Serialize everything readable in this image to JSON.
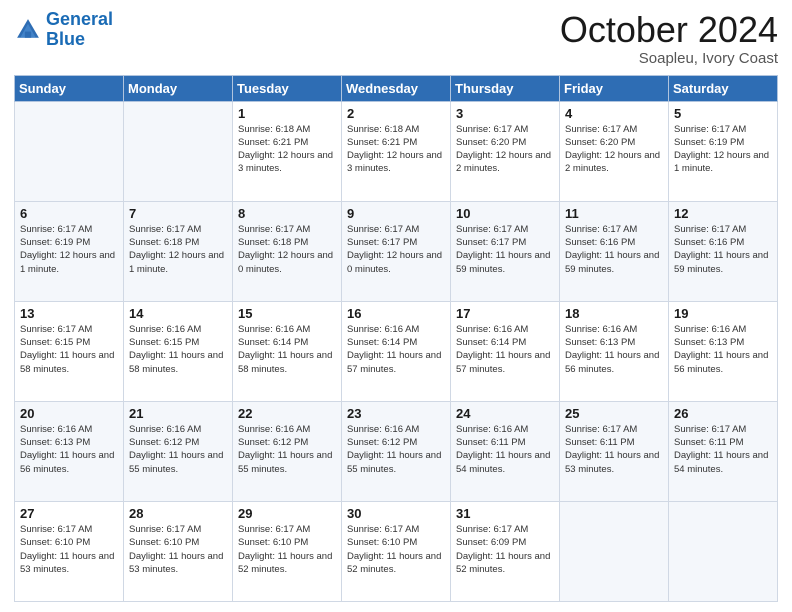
{
  "header": {
    "logo_line1": "General",
    "logo_line2": "Blue",
    "month": "October 2024",
    "location": "Soapleu, Ivory Coast"
  },
  "weekdays": [
    "Sunday",
    "Monday",
    "Tuesday",
    "Wednesday",
    "Thursday",
    "Friday",
    "Saturday"
  ],
  "weeks": [
    [
      {
        "day": null
      },
      {
        "day": null
      },
      {
        "day": "1",
        "sunrise": "Sunrise: 6:18 AM",
        "sunset": "Sunset: 6:21 PM",
        "daylight": "Daylight: 12 hours and 3 minutes."
      },
      {
        "day": "2",
        "sunrise": "Sunrise: 6:18 AM",
        "sunset": "Sunset: 6:21 PM",
        "daylight": "Daylight: 12 hours and 3 minutes."
      },
      {
        "day": "3",
        "sunrise": "Sunrise: 6:17 AM",
        "sunset": "Sunset: 6:20 PM",
        "daylight": "Daylight: 12 hours and 2 minutes."
      },
      {
        "day": "4",
        "sunrise": "Sunrise: 6:17 AM",
        "sunset": "Sunset: 6:20 PM",
        "daylight": "Daylight: 12 hours and 2 minutes."
      },
      {
        "day": "5",
        "sunrise": "Sunrise: 6:17 AM",
        "sunset": "Sunset: 6:19 PM",
        "daylight": "Daylight: 12 hours and 1 minute."
      }
    ],
    [
      {
        "day": "6",
        "sunrise": "Sunrise: 6:17 AM",
        "sunset": "Sunset: 6:19 PM",
        "daylight": "Daylight: 12 hours and 1 minute."
      },
      {
        "day": "7",
        "sunrise": "Sunrise: 6:17 AM",
        "sunset": "Sunset: 6:18 PM",
        "daylight": "Daylight: 12 hours and 1 minute."
      },
      {
        "day": "8",
        "sunrise": "Sunrise: 6:17 AM",
        "sunset": "Sunset: 6:18 PM",
        "daylight": "Daylight: 12 hours and 0 minutes."
      },
      {
        "day": "9",
        "sunrise": "Sunrise: 6:17 AM",
        "sunset": "Sunset: 6:17 PM",
        "daylight": "Daylight: 12 hours and 0 minutes."
      },
      {
        "day": "10",
        "sunrise": "Sunrise: 6:17 AM",
        "sunset": "Sunset: 6:17 PM",
        "daylight": "Daylight: 11 hours and 59 minutes."
      },
      {
        "day": "11",
        "sunrise": "Sunrise: 6:17 AM",
        "sunset": "Sunset: 6:16 PM",
        "daylight": "Daylight: 11 hours and 59 minutes."
      },
      {
        "day": "12",
        "sunrise": "Sunrise: 6:17 AM",
        "sunset": "Sunset: 6:16 PM",
        "daylight": "Daylight: 11 hours and 59 minutes."
      }
    ],
    [
      {
        "day": "13",
        "sunrise": "Sunrise: 6:17 AM",
        "sunset": "Sunset: 6:15 PM",
        "daylight": "Daylight: 11 hours and 58 minutes."
      },
      {
        "day": "14",
        "sunrise": "Sunrise: 6:16 AM",
        "sunset": "Sunset: 6:15 PM",
        "daylight": "Daylight: 11 hours and 58 minutes."
      },
      {
        "day": "15",
        "sunrise": "Sunrise: 6:16 AM",
        "sunset": "Sunset: 6:14 PM",
        "daylight": "Daylight: 11 hours and 58 minutes."
      },
      {
        "day": "16",
        "sunrise": "Sunrise: 6:16 AM",
        "sunset": "Sunset: 6:14 PM",
        "daylight": "Daylight: 11 hours and 57 minutes."
      },
      {
        "day": "17",
        "sunrise": "Sunrise: 6:16 AM",
        "sunset": "Sunset: 6:14 PM",
        "daylight": "Daylight: 11 hours and 57 minutes."
      },
      {
        "day": "18",
        "sunrise": "Sunrise: 6:16 AM",
        "sunset": "Sunset: 6:13 PM",
        "daylight": "Daylight: 11 hours and 56 minutes."
      },
      {
        "day": "19",
        "sunrise": "Sunrise: 6:16 AM",
        "sunset": "Sunset: 6:13 PM",
        "daylight": "Daylight: 11 hours and 56 minutes."
      }
    ],
    [
      {
        "day": "20",
        "sunrise": "Sunrise: 6:16 AM",
        "sunset": "Sunset: 6:13 PM",
        "daylight": "Daylight: 11 hours and 56 minutes."
      },
      {
        "day": "21",
        "sunrise": "Sunrise: 6:16 AM",
        "sunset": "Sunset: 6:12 PM",
        "daylight": "Daylight: 11 hours and 55 minutes."
      },
      {
        "day": "22",
        "sunrise": "Sunrise: 6:16 AM",
        "sunset": "Sunset: 6:12 PM",
        "daylight": "Daylight: 11 hours and 55 minutes."
      },
      {
        "day": "23",
        "sunrise": "Sunrise: 6:16 AM",
        "sunset": "Sunset: 6:12 PM",
        "daylight": "Daylight: 11 hours and 55 minutes."
      },
      {
        "day": "24",
        "sunrise": "Sunrise: 6:16 AM",
        "sunset": "Sunset: 6:11 PM",
        "daylight": "Daylight: 11 hours and 54 minutes."
      },
      {
        "day": "25",
        "sunrise": "Sunrise: 6:17 AM",
        "sunset": "Sunset: 6:11 PM",
        "daylight": "Daylight: 11 hours and 53 minutes."
      },
      {
        "day": "26",
        "sunrise": "Sunrise: 6:17 AM",
        "sunset": "Sunset: 6:11 PM",
        "daylight": "Daylight: 11 hours and 54 minutes."
      }
    ],
    [
      {
        "day": "27",
        "sunrise": "Sunrise: 6:17 AM",
        "sunset": "Sunset: 6:10 PM",
        "daylight": "Daylight: 11 hours and 53 minutes."
      },
      {
        "day": "28",
        "sunrise": "Sunrise: 6:17 AM",
        "sunset": "Sunset: 6:10 PM",
        "daylight": "Daylight: 11 hours and 53 minutes."
      },
      {
        "day": "29",
        "sunrise": "Sunrise: 6:17 AM",
        "sunset": "Sunset: 6:10 PM",
        "daylight": "Daylight: 11 hours and 52 minutes."
      },
      {
        "day": "30",
        "sunrise": "Sunrise: 6:17 AM",
        "sunset": "Sunset: 6:10 PM",
        "daylight": "Daylight: 11 hours and 52 minutes."
      },
      {
        "day": "31",
        "sunrise": "Sunrise: 6:17 AM",
        "sunset": "Sunset: 6:09 PM",
        "daylight": "Daylight: 11 hours and 52 minutes."
      },
      {
        "day": null
      },
      {
        "day": null
      }
    ]
  ]
}
